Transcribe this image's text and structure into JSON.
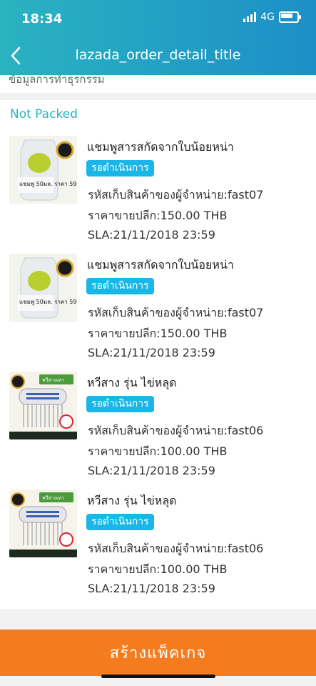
{
  "status": {
    "time": "18:34",
    "network": "4G"
  },
  "nav": {
    "title": "lazada_order_detail_title"
  },
  "partial_text": "ข้อมูลการทำธุรกรรม",
  "section_label": "Not Packed",
  "items": [
    {
      "title": "แชมพูสารสกัดจากใบน้อยหน่า",
      "status": "รอดำเนินการ",
      "seller_sku": "รหัสเก็บสินค้าของผู้จำหน่าย:fast07",
      "price": "ราคาขายปลีก:150.00 THB",
      "sla": "SLA:21/11/2018 23:59",
      "thumb_text": "แชมพู 50มล. ราคา 59.-"
    },
    {
      "title": "แชมพูสารสกัดจากใบน้อยหน่า",
      "status": "รอดำเนินการ",
      "seller_sku": "รหัสเก็บสินค้าของผู้จำหน่าย:fast07",
      "price": "ราคาขายปลีก:150.00 THB",
      "sla": "SLA:21/11/2018 23:59",
      "thumb_text": "แชมพู 50มล. ราคา 59.-"
    },
    {
      "title": "หวีสาง รุ่น ไข่หลุด",
      "status": "รอดำเนินการ",
      "seller_sku": "รหัสเก็บสินค้าของผู้จำหน่าย:fast06",
      "price": "ราคาขายปลีก:100.00 THB",
      "sla": "SLA:21/11/2018 23:59",
      "thumb_text": "หวีสางเหา"
    },
    {
      "title": "หวีสาง รุ่น ไข่หลุด",
      "status": "รอดำเนินการ",
      "seller_sku": "รหัสเก็บสินค้าของผู้จำหน่าย:fast06",
      "price": "ราคาขายปลีก:100.00 THB",
      "sla": "SLA:21/11/2018 23:59",
      "thumb_text": "หวีสางเหา"
    }
  ],
  "action": {
    "create_package": "สร้างแพ็คเกจ"
  },
  "colors": {
    "accent": "#2ab3c0",
    "badge": "#19b6e8",
    "cta": "#f57b1f"
  },
  "icons": {
    "back": "chevron-left-icon",
    "signal": "signal-icon",
    "battery": "battery-icon"
  }
}
